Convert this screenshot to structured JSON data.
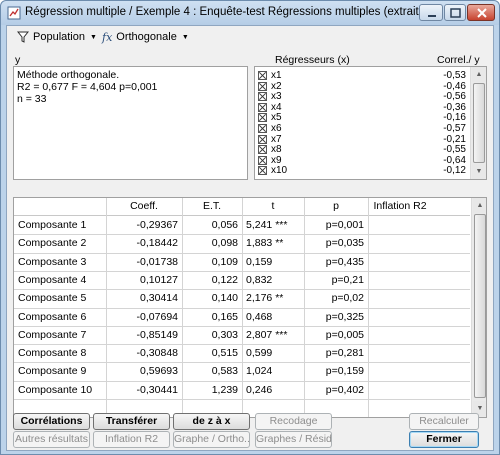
{
  "window": {
    "title": "Régression multiple / Exemple 4 : Enquête-test Régressions multiples (extrait..."
  },
  "toolbar": {
    "population_label": "Population",
    "population_icon": "filter-icon",
    "method_label": "Orthogonale",
    "method_icon": "function-fx-icon"
  },
  "summary": {
    "var_label": "y",
    "lines": [
      "Méthode orthogonale.",
      "R2 = 0,677   F = 4,604   p=0,001",
      "n = 33"
    ]
  },
  "regressors": {
    "header": "Régresseurs (x)",
    "corr_header": "Correl./ y",
    "items": [
      {
        "name": "x1",
        "corr": "-0,53"
      },
      {
        "name": "x2",
        "corr": "-0,46"
      },
      {
        "name": "x3",
        "corr": "-0,56"
      },
      {
        "name": "x4",
        "corr": "-0,36"
      },
      {
        "name": "x5",
        "corr": "-0,16"
      },
      {
        "name": "x6",
        "corr": "-0,57"
      },
      {
        "name": "x7",
        "corr": "-0,21"
      },
      {
        "name": "x8",
        "corr": "-0,55"
      },
      {
        "name": "x9",
        "corr": "-0,64"
      },
      {
        "name": "x10",
        "corr": "-0,12"
      }
    ]
  },
  "table": {
    "columns": [
      "",
      "Coeff.",
      "E.T.",
      "t",
      "p",
      "Inflation R2"
    ],
    "rows": [
      [
        "Composante  1",
        "-0,29367",
        "0,056",
        "5,241 ***",
        "p=0,001",
        ""
      ],
      [
        "Composante  2",
        "-0,18442",
        "0,098",
        "1,883 **",
        "p=0,035",
        ""
      ],
      [
        "Composante  3",
        "-0,01738",
        "0,109",
        "0,159",
        "p=0,435",
        ""
      ],
      [
        "Composante  4",
        "0,10127",
        "0,122",
        "0,832",
        "p=0,21",
        ""
      ],
      [
        "Composante  5",
        "0,30414",
        "0,140",
        "2,176 **",
        "p=0,02",
        ""
      ],
      [
        "Composante  6",
        "-0,07694",
        "0,165",
        "0,468",
        "p=0,325",
        ""
      ],
      [
        "Composante  7",
        "-0,85149",
        "0,303",
        "2,807 ***",
        "p=0,005",
        ""
      ],
      [
        "Composante  8",
        "-0,30848",
        "0,515",
        "0,599",
        "p=0,281",
        ""
      ],
      [
        "Composante  9",
        "0,59693",
        "0,583",
        "1,024",
        "p=0,159",
        ""
      ],
      [
        "Composante  10",
        "-0,30441",
        "1,239",
        "0,246",
        "p=0,402",
        ""
      ]
    ]
  },
  "buttons": {
    "correlations": "Corrélations",
    "transferer": "Transférer",
    "de_z_a_x": "de z à x",
    "recodage": "Recodage",
    "recalculer": "Recalculer",
    "autres_resultats": "Autres résultats",
    "inflation_r2": "Inflation R2",
    "graphe_ortho": "Graphe / Ortho...",
    "graphes_resid": "Graphes / Résid...",
    "fermer": "Fermer"
  }
}
